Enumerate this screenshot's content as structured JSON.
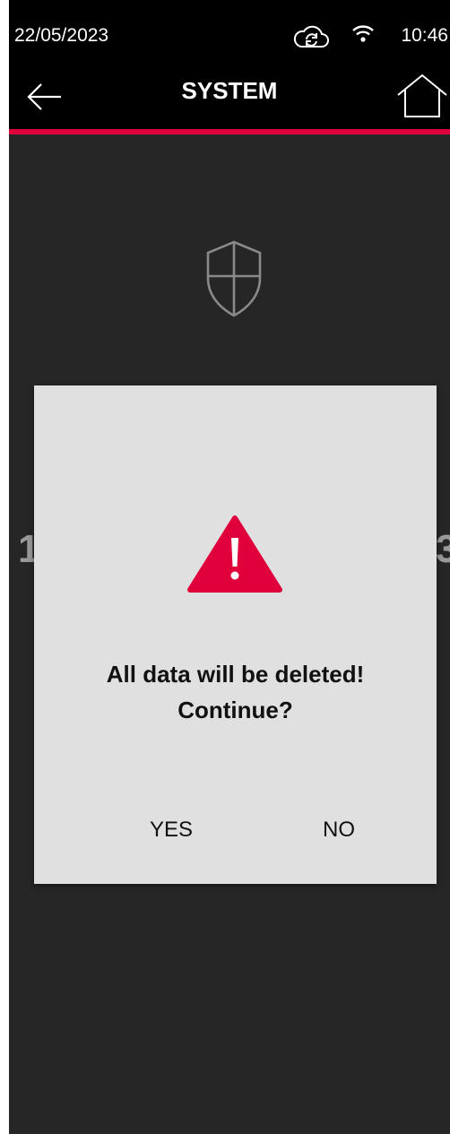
{
  "status_bar": {
    "date": "22/05/2023",
    "time": "10:46",
    "icons": [
      "cloud-sync-icon",
      "wifi-icon"
    ]
  },
  "header": {
    "title": "SYSTEM",
    "back_icon": "arrow-left-icon",
    "home_icon": "home-icon",
    "accent_color": "#e0003c"
  },
  "background": {
    "icon": "shield-icon",
    "left_number": "1",
    "right_number": "3"
  },
  "dialog": {
    "icon": "warning-triangle-icon",
    "icon_color": "#e0003c",
    "message_line1": "All data will be deleted!",
    "message_line2": "Continue?",
    "yes_label": "YES",
    "no_label": "NO"
  }
}
